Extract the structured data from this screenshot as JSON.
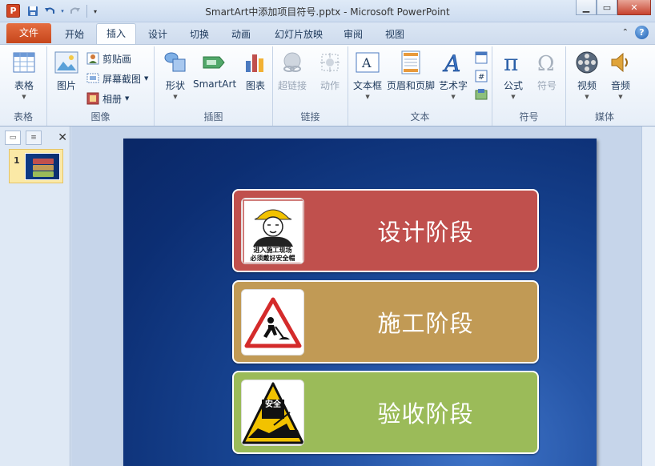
{
  "window": {
    "title": "SmartArt中添加项目符号.pptx - Microsoft PowerPoint",
    "app_icon_letter": "P"
  },
  "quick_access": {
    "icons": [
      "save-icon",
      "undo-icon",
      "redo-icon",
      "customize-icon"
    ]
  },
  "tabs": {
    "file": "文件",
    "items": [
      "开始",
      "插入",
      "设计",
      "切换",
      "动画",
      "幻灯片放映",
      "审阅",
      "视图"
    ],
    "active": "插入"
  },
  "ribbon": {
    "groups": {
      "tables": "表格",
      "images": "图像",
      "illustrations": "插图",
      "links": "链接",
      "text": "文本",
      "symbols": "符号",
      "media": "媒体"
    },
    "buttons": {
      "table": "表格",
      "picture": "图片",
      "clipart": "剪贴画",
      "screenshot": "屏幕截图",
      "album": "相册",
      "shapes": "形状",
      "smartart": "SmartArt",
      "chart": "图表",
      "hyperlink": "超链接",
      "action": "动作",
      "textbox": "文本框",
      "header_footer": "页眉和页脚",
      "wordart": "艺术字",
      "equation": "公式",
      "symbol": "符号",
      "video": "视频",
      "audio": "音频"
    }
  },
  "thumbnail_pane": {
    "slide_number": "1"
  },
  "slide": {
    "items": [
      {
        "label": "设计阶段",
        "color": "#c0504d",
        "sign_text_1": "进入施工现场",
        "sign_text_2": "必须戴好安全帽"
      },
      {
        "label": "施工阶段",
        "color": "#c19a55"
      },
      {
        "label": "验收阶段",
        "color": "#9bbb59",
        "sign_text_1": "安全"
      }
    ]
  },
  "colors": {
    "file_tab": "#d24726",
    "slide_bg": "#0c2e73"
  }
}
